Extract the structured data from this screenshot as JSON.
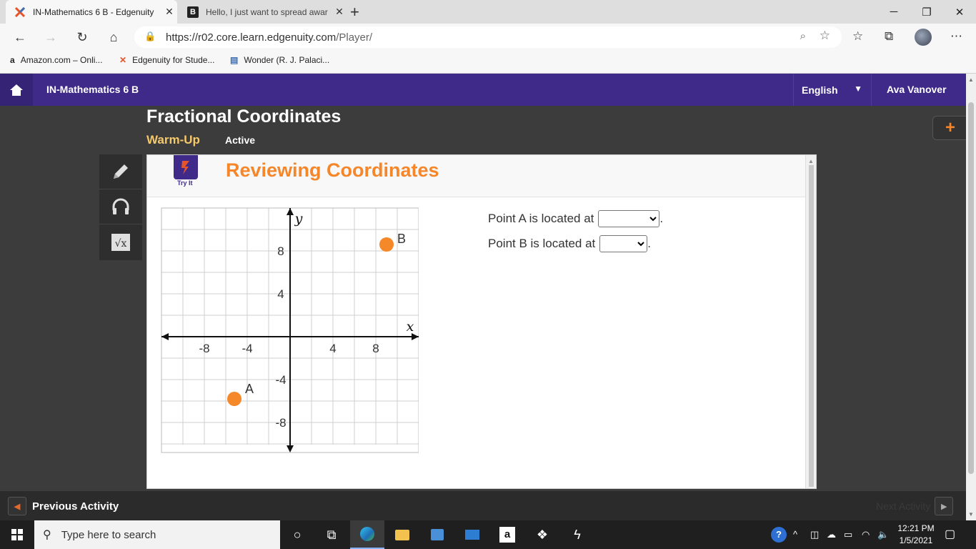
{
  "browser": {
    "tabs": [
      {
        "title": "IN-Mathematics 6 B - Edgenuity",
        "favicon": "edgenuity-x-icon"
      },
      {
        "title": "Hello, I just want to spread awar",
        "favicon": "brainly-b-icon"
      }
    ],
    "url_host": "https://r02.core.learn.edgenuity.com",
    "url_path": "/Player/",
    "favorites": [
      {
        "label": "Amazon.com – Onli...",
        "icon": "a"
      },
      {
        "label": "Edgenuity for Stude...",
        "icon": "X"
      },
      {
        "label": "Wonder (R. J. Palaci...",
        "icon": "📘"
      }
    ]
  },
  "app": {
    "course": "IN-Mathematics 6 B",
    "language": "English",
    "user": "Ava Vanover",
    "lesson_title": "Fractional Coordinates",
    "lesson_sub": "Warm-Up",
    "lesson_status": "Active",
    "tryit_label": "Try It",
    "section_title": "Reviewing Coordinates",
    "question_a": "Point A is located at",
    "question_b": "Point B is located at",
    "punct": ".",
    "prev_label": "Previous Activity",
    "next_label": "Next Activity"
  },
  "graph": {
    "x_axis_label": "x",
    "y_axis_label": "y",
    "x_ticks": [
      "-8",
      "-4",
      "4",
      "8"
    ],
    "y_ticks": [
      "8",
      "4",
      "-4",
      "-8"
    ],
    "range": [
      -12,
      12
    ],
    "points": [
      {
        "name": "A",
        "x": -5.2,
        "y": -5.8
      },
      {
        "name": "B",
        "x": 9,
        "y": 8.6
      }
    ],
    "point_color": "#f5892a"
  },
  "taskbar": {
    "search_placeholder": "Type here to search",
    "time": "12:21 PM",
    "date": "1/5/2021"
  },
  "colors": {
    "nav_purple": "#3f2a8a",
    "accent_orange": "#f5862a",
    "subtitle_gold": "#f5c96a"
  }
}
